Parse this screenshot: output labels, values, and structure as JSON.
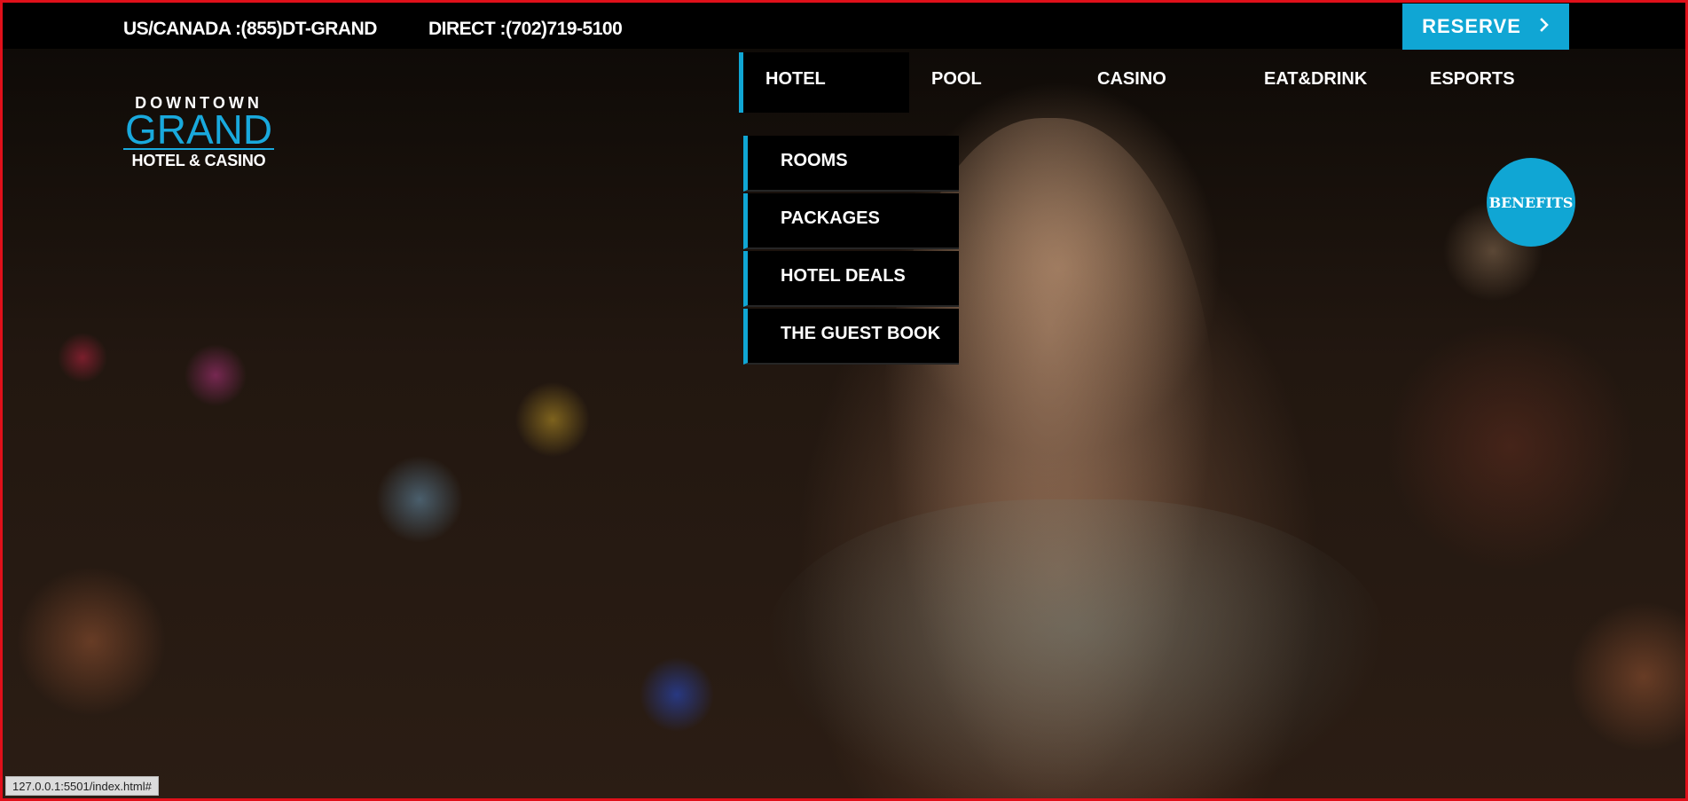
{
  "topbar": {
    "phone_us": "US/CANADA :(855)DT-GRAND",
    "phone_direct": "DIRECT :(702)719-5100",
    "reserve_label": "RESERVE",
    "reserve_icon": "chevron-right-icon"
  },
  "logo": {
    "top": "DOWNTOWN",
    "middle": "GRAND",
    "bottom": "HOTEL & CASINO"
  },
  "nav": {
    "items": [
      {
        "label": "HOTEL",
        "active": true
      },
      {
        "label": "POOL"
      },
      {
        "label": "CASINO"
      },
      {
        "label": "EAT&DRINK"
      },
      {
        "label": "ESPORTS"
      }
    ]
  },
  "dropdown": {
    "items": [
      {
        "label": "ROOMS"
      },
      {
        "label": "PACKAGES"
      },
      {
        "label": "HOTEL DEALS"
      },
      {
        "label": "THE GUEST BOOK"
      }
    ]
  },
  "benefits": {
    "label": "BENEFITS"
  },
  "status": {
    "url": "127.0.0.1:5501/index.html#"
  },
  "colors": {
    "accent": "#10a6d4",
    "topbar": "#000000",
    "frame_border": "#e0101a"
  }
}
